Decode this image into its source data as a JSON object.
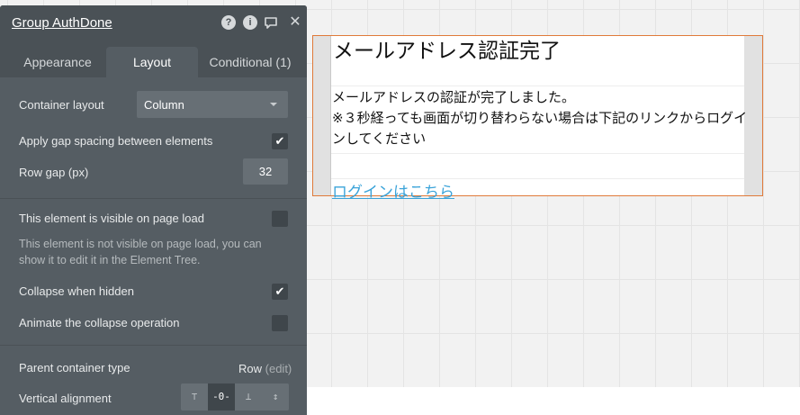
{
  "panel": {
    "title": "Group AuthDone",
    "icons": [
      "help-icon",
      "info-icon",
      "comment-icon",
      "close-icon"
    ],
    "tabs": [
      {
        "label": "Appearance",
        "active": false
      },
      {
        "label": "Layout",
        "active": true
      },
      {
        "label": "Conditional (1)",
        "active": false
      }
    ],
    "container_layout": {
      "label": "Container layout",
      "value": "Column"
    },
    "gap_spacing": {
      "label": "Apply gap spacing between elements",
      "checked": true
    },
    "row_gap": {
      "label": "Row gap (px)",
      "value": "32"
    },
    "visible_on_load": {
      "label": "This element is visible on page load",
      "checked": false
    },
    "hint": "This element is not visible on page load, you can show it to edit it in the Element Tree.",
    "collapse_hidden": {
      "label": "Collapse when hidden",
      "checked": true
    },
    "animate_collapse": {
      "label": "Animate the collapse operation",
      "checked": false
    },
    "parent_container": {
      "label": "Parent container type",
      "value": "Row",
      "edit": "(edit)"
    },
    "vertical_alignment": {
      "label": "Vertical alignment",
      "options": [
        "top",
        "center",
        "bottom",
        "stretch"
      ],
      "selected": "center"
    }
  },
  "canvas": {
    "group": {
      "title": "メールアドレス認証完了",
      "message": "メールアドレスの認証が完了しました。\n※３秒経っても画面が切り替わらない場合は下記のリンクからログインしてください",
      "link": "ログインはこちら"
    },
    "colors": {
      "selection_border": "#e07a3a",
      "link": "#3aa3d9",
      "panel_bg": "#555d63"
    }
  }
}
